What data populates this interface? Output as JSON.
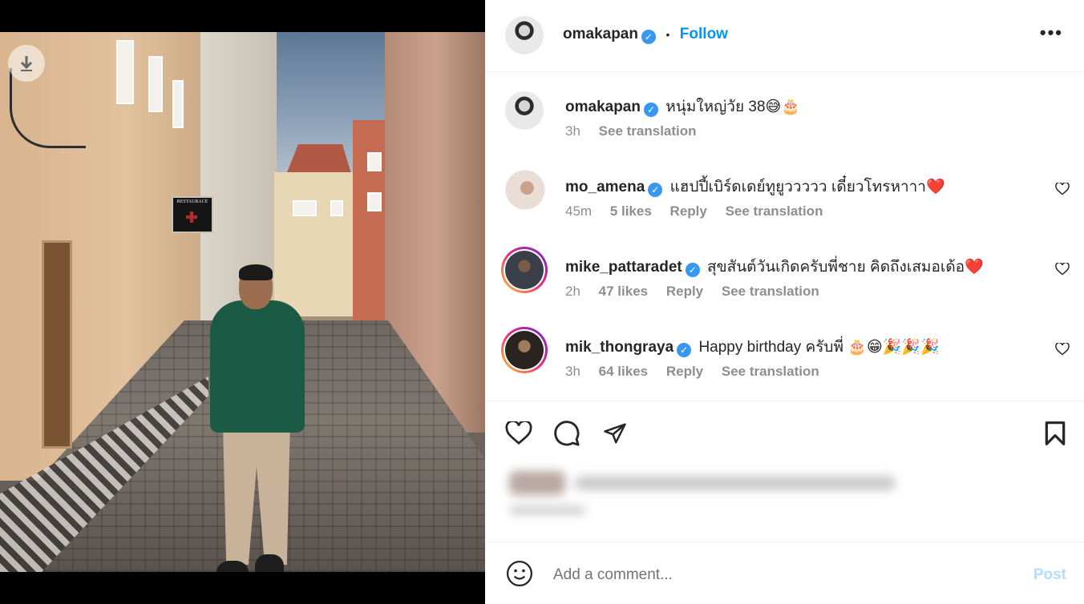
{
  "post": {
    "author": "omakapan",
    "follow_label": "Follow",
    "separator": "•",
    "more_label": "•••",
    "caption": {
      "username": "omakapan",
      "text": "หนุ่มใหญ่วัย 38😅🎂",
      "time": "3h",
      "translation": "See translation"
    },
    "photo": {
      "sign_text": "RESTAURACE",
      "download_icon": "download-icon"
    }
  },
  "comments": [
    {
      "username": "mo_amena",
      "text": "แฮปปี้เบิร์ดเดย์ทูยูววววว เดี๋ยวโทรหาาา❤️",
      "time": "45m",
      "likes": "5 likes",
      "reply": "Reply",
      "translation": "See translation"
    },
    {
      "username": "mike_pattaradet",
      "text": "สุขสันต์วันเกิดครับพี่ชาย คิดถึงเสมอเด้อ❤️",
      "time": "2h",
      "likes": "47 likes",
      "reply": "Reply",
      "translation": "See translation"
    },
    {
      "username": "mik_thongraya",
      "text": "Happy birthday ครับพี่ 🎂😁🎉🎉🎉",
      "time": "3h",
      "likes": "64 likes",
      "reply": "Reply",
      "translation": "See translation"
    }
  ],
  "actions": {
    "like_icon": "heart-icon",
    "comment_icon": "comment-icon",
    "share_icon": "paper-plane-icon",
    "save_icon": "bookmark-icon"
  },
  "add_comment": {
    "placeholder": "Add a comment...",
    "post_label": "Post",
    "emoji_icon": "smiley-icon"
  },
  "colors": {
    "accent": "#0095f6",
    "verified": "#3897f0",
    "muted": "#8e8e8e",
    "post_disabled": "#b2dffc"
  }
}
